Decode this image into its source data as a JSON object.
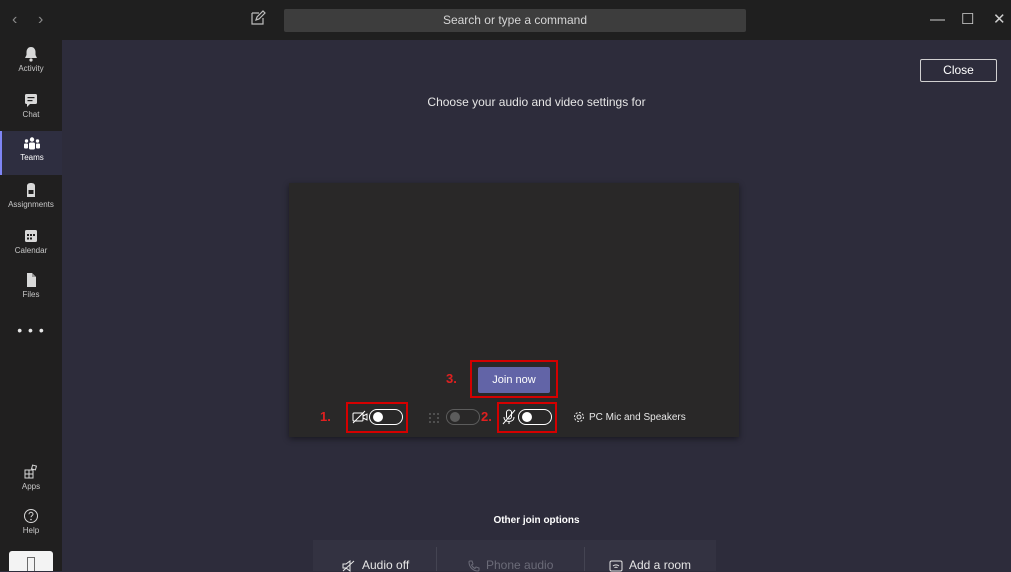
{
  "topbar": {
    "back": "‹",
    "forward": "›",
    "search_placeholder": "Search or type a command",
    "minimize": "—",
    "maximize": "☐",
    "close": "✕"
  },
  "rail": {
    "items": [
      {
        "label": "Activity",
        "icon": "bell-icon"
      },
      {
        "label": "Chat",
        "icon": "chat-icon"
      },
      {
        "label": "Teams",
        "icon": "teams-icon",
        "active": true
      },
      {
        "label": "Assignments",
        "icon": "backpack-icon"
      },
      {
        "label": "Calendar",
        "icon": "calendar-icon"
      },
      {
        "label": "Files",
        "icon": "file-icon"
      }
    ],
    "more": "• • •",
    "bottom": [
      {
        "label": "Apps",
        "icon": "apps-icon"
      },
      {
        "label": "Help",
        "icon": "help-icon"
      }
    ]
  },
  "main": {
    "close_label": "Close",
    "heading": "Choose your audio and video settings for",
    "join_label": "Join now",
    "steps": {
      "one": "1.",
      "two": "2.",
      "three": "3."
    },
    "device_label": "PC Mic and Speakers",
    "other_options_title": "Other join options",
    "options": {
      "audio_off": "Audio off",
      "phone_audio": "Phone audio",
      "add_room": "Add a room"
    }
  },
  "colors": {
    "accent": "#6264a7",
    "highlight": "#d40000",
    "background": "#2d2c3b"
  }
}
